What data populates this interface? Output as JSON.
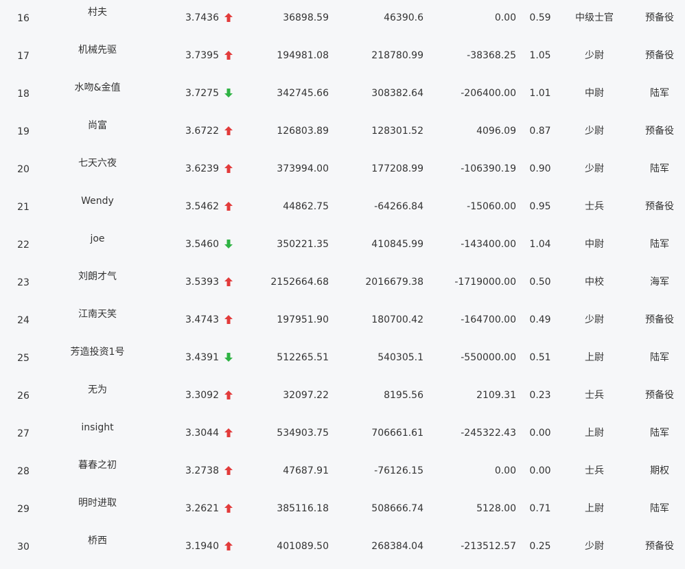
{
  "colors": {
    "up": "#e23b3b",
    "down": "#2fb344",
    "text": "#333333",
    "background": "#f6f7f9"
  },
  "rows": [
    {
      "rank": "16",
      "name": "村夫",
      "score": "3.7436",
      "trend": "up",
      "v1": "36898.59",
      "v2": "46390.6",
      "v3": "0.00",
      "ratio": "0.59",
      "level": "中级士官",
      "group": "预备役"
    },
    {
      "rank": "17",
      "name": "机械先驱",
      "score": "3.7395",
      "trend": "up",
      "v1": "194981.08",
      "v2": "218780.99",
      "v3": "-38368.25",
      "ratio": "1.05",
      "level": "少尉",
      "group": "预备役"
    },
    {
      "rank": "18",
      "name": "水吻&金值",
      "score": "3.7275",
      "trend": "down",
      "v1": "342745.66",
      "v2": "308382.64",
      "v3": "-206400.00",
      "ratio": "1.01",
      "level": "中尉",
      "group": "陆军"
    },
    {
      "rank": "19",
      "name": "尚富",
      "score": "3.6722",
      "trend": "up",
      "v1": "126803.89",
      "v2": "128301.52",
      "v3": "4096.09",
      "ratio": "0.87",
      "level": "少尉",
      "group": "预备役"
    },
    {
      "rank": "20",
      "name": "七天六夜",
      "score": "3.6239",
      "trend": "up",
      "v1": "373994.00",
      "v2": "177208.99",
      "v3": "-106390.19",
      "ratio": "0.90",
      "level": "少尉",
      "group": "陆军"
    },
    {
      "rank": "21",
      "name": "Wendy",
      "score": "3.5462",
      "trend": "up",
      "v1": "44862.75",
      "v2": "-64266.84",
      "v3": "-15060.00",
      "ratio": "0.95",
      "level": "士兵",
      "group": "预备役"
    },
    {
      "rank": "22",
      "name": "joe",
      "score": "3.5460",
      "trend": "down",
      "v1": "350221.35",
      "v2": "410845.99",
      "v3": "-143400.00",
      "ratio": "1.04",
      "level": "中尉",
      "group": "陆军"
    },
    {
      "rank": "23",
      "name": "刘朗才气",
      "score": "3.5393",
      "trend": "up",
      "v1": "2152664.68",
      "v2": "2016679.38",
      "v3": "-1719000.00",
      "ratio": "0.50",
      "level": "中校",
      "group": "海军"
    },
    {
      "rank": "24",
      "name": "江南天笑",
      "score": "3.4743",
      "trend": "up",
      "v1": "197951.90",
      "v2": "180700.42",
      "v3": "-164700.00",
      "ratio": "0.49",
      "level": "少尉",
      "group": "预备役"
    },
    {
      "rank": "25",
      "name": "芳造投资1号",
      "score": "3.4391",
      "trend": "down",
      "v1": "512265.51",
      "v2": "540305.1",
      "v3": "-550000.00",
      "ratio": "0.51",
      "level": "上尉",
      "group": "陆军"
    },
    {
      "rank": "26",
      "name": "无为",
      "score": "3.3092",
      "trend": "up",
      "v1": "32097.22",
      "v2": "8195.56",
      "v3": "2109.31",
      "ratio": "0.23",
      "level": "士兵",
      "group": "预备役"
    },
    {
      "rank": "27",
      "name": "insight",
      "score": "3.3044",
      "trend": "up",
      "v1": "534903.75",
      "v2": "706661.61",
      "v3": "-245322.43",
      "ratio": "0.00",
      "level": "上尉",
      "group": "陆军"
    },
    {
      "rank": "28",
      "name": "暮春之初",
      "score": "3.2738",
      "trend": "up",
      "v1": "47687.91",
      "v2": "-76126.15",
      "v3": "0.00",
      "ratio": "0.00",
      "level": "士兵",
      "group": "期权"
    },
    {
      "rank": "29",
      "name": "明时进取",
      "score": "3.2621",
      "trend": "up",
      "v1": "385116.18",
      "v2": "508666.74",
      "v3": "5128.00",
      "ratio": "0.71",
      "level": "上尉",
      "group": "陆军"
    },
    {
      "rank": "30",
      "name": "桥西",
      "score": "3.1940",
      "trend": "up",
      "v1": "401089.50",
      "v2": "268384.04",
      "v3": "-213512.57",
      "ratio": "0.25",
      "level": "少尉",
      "group": "预备役"
    }
  ]
}
